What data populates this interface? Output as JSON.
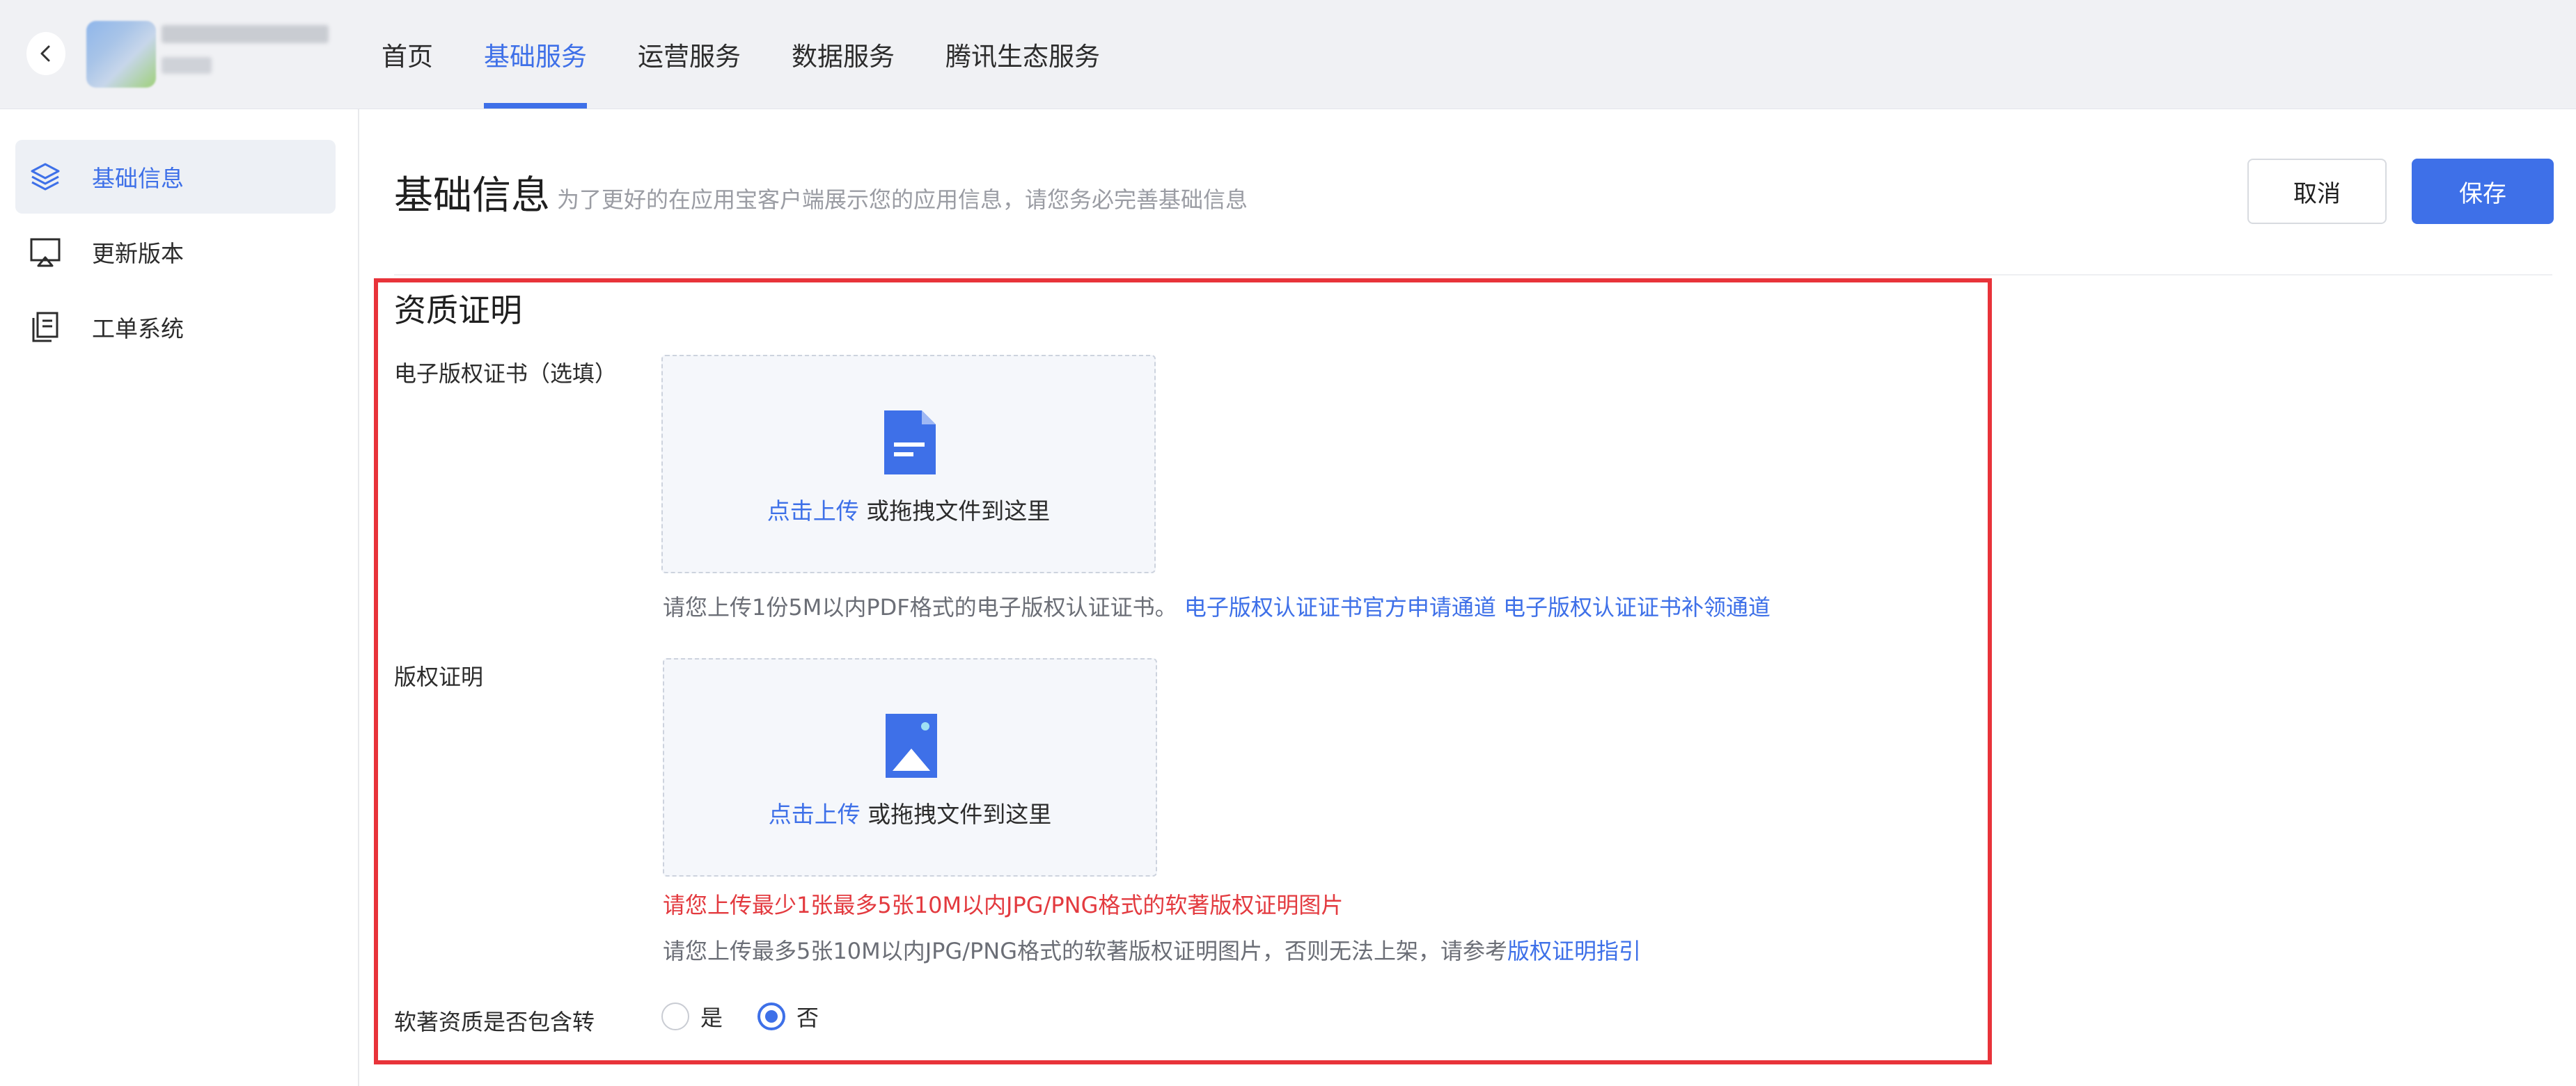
{
  "nav": {
    "tabs": [
      {
        "label": "首页",
        "active": false
      },
      {
        "label": "基础服务",
        "active": true
      },
      {
        "label": "运营服务",
        "active": false
      },
      {
        "label": "数据服务",
        "active": false
      },
      {
        "label": "腾讯生态服务",
        "active": false
      }
    ]
  },
  "sidebar": {
    "items": [
      {
        "label": "基础信息",
        "icon": "layers-icon",
        "active": true
      },
      {
        "label": "更新版本",
        "icon": "screen-upload-icon",
        "active": false
      },
      {
        "label": "工单系统",
        "icon": "document-copy-icon",
        "active": false
      }
    ]
  },
  "header": {
    "title": "基础信息",
    "subtitle": "为了更好的在应用宝客户端展示您的应用信息，请您务必完善基础信息",
    "cancel_label": "取消",
    "save_label": "保存"
  },
  "section": {
    "title": "资质证明",
    "ecert": {
      "label": "电子版权证书（选填）",
      "upload_link": "点击上传",
      "upload_text": " 或拖拽文件到这里",
      "hint": "请您上传1份5M以内PDF格式的电子版权认证证书。",
      "link1": "电子版权认证证书官方申请通道",
      "link2": "电子版权认证证书补领通道"
    },
    "copyright": {
      "label": "版权证明",
      "upload_link": "点击上传",
      "upload_text": " 或拖拽文件到这里",
      "error": "请您上传最少1张最多5张10M以内JPG/PNG格式的软著版权证明图片",
      "hint": "请您上传最多5张10M以内JPG/PNG格式的软著版权证明图片，否则无法上架，请参考",
      "hint_link": "版权证明指引"
    },
    "transfer": {
      "label": "软著资质是否包含转",
      "options": [
        {
          "label": "是",
          "checked": false
        },
        {
          "label": "否",
          "checked": true
        }
      ]
    }
  },
  "colors": {
    "accent": "#3e70e8",
    "error": "#e33a3f",
    "highlight_border": "#e8333a"
  }
}
